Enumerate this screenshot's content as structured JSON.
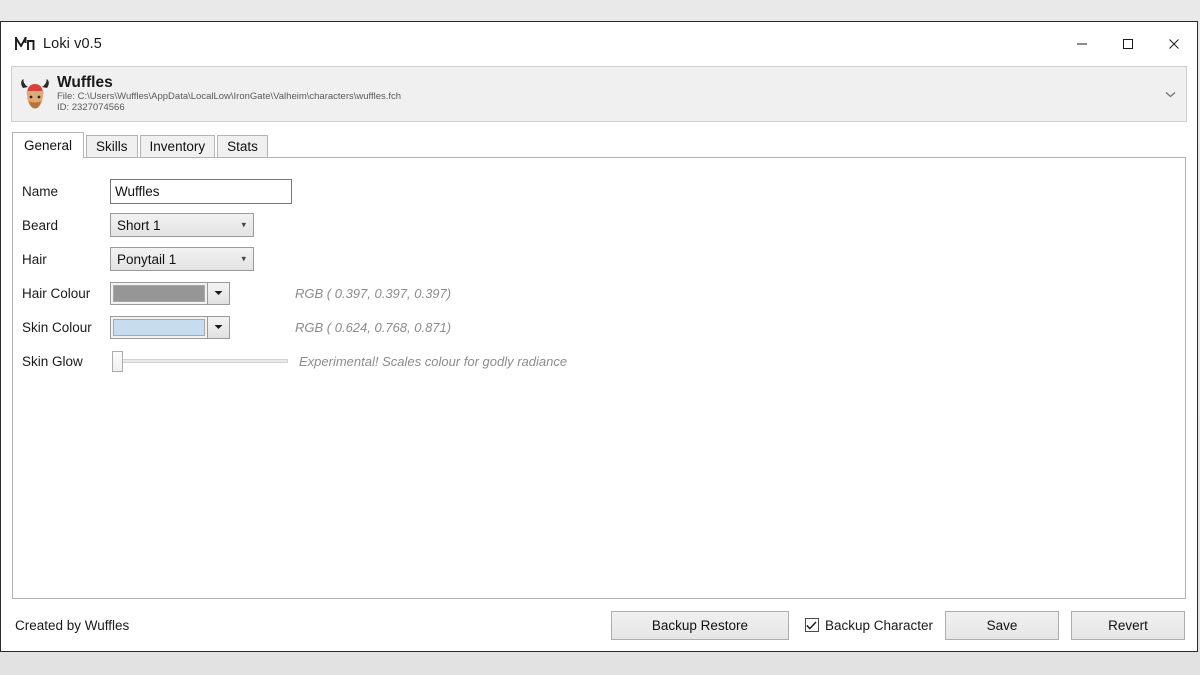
{
  "window": {
    "title": "Loki v0.5",
    "app_icon": "loki-horns-icon",
    "controls": {
      "minimize": "minimize-icon",
      "maximize": "maximize-icon",
      "close": "close-icon"
    }
  },
  "character_header": {
    "avatar_icon": "viking-helmet-icon",
    "name": "Wuffles",
    "file": "File: C:\\Users\\Wuffles\\AppData\\LocalLow\\IronGate\\Valheim\\characters\\wuffles.fch",
    "id": "ID: 2327074566",
    "expand_icon": "chevron-down-icon"
  },
  "tabs": [
    {
      "label": "General",
      "active": true
    },
    {
      "label": "Skills",
      "active": false
    },
    {
      "label": "Inventory",
      "active": false
    },
    {
      "label": "Stats",
      "active": false
    }
  ],
  "general": {
    "name": {
      "label": "Name",
      "value": "Wuffles",
      "placeholder": ""
    },
    "beard": {
      "label": "Beard",
      "value": "Short 1"
    },
    "hair": {
      "label": "Hair",
      "value": "Ponytail 1"
    },
    "hair_colour": {
      "label": "Hair Colour",
      "swatch": "#969696",
      "rgb_text": "RGB ( 0.397, 0.397, 0.397)"
    },
    "skin_colour": {
      "label": "Skin Colour",
      "swatch": "#c5ddef",
      "rgb_text": "RGB ( 0.624, 0.768, 0.871)"
    },
    "skin_glow": {
      "label": "Skin Glow",
      "value": 0,
      "min": 0,
      "max": 100,
      "hint": "Experimental! Scales colour for godly radiance"
    }
  },
  "footer": {
    "credit": "Created by Wuffles",
    "backup_restore_label": "Backup Restore",
    "backup_character_label": "Backup Character",
    "backup_character_checked": true,
    "save_label": "Save",
    "revert_label": "Revert"
  }
}
